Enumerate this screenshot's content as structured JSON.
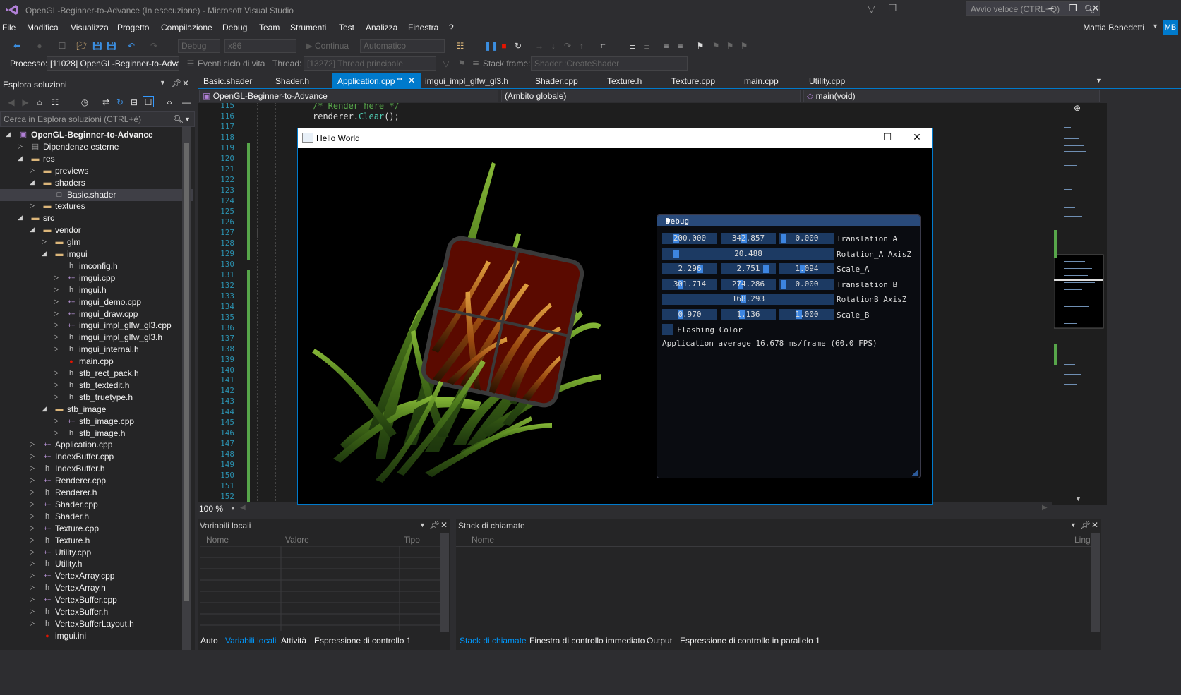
{
  "window": {
    "title": "OpenGL-Beginner-to-Advance (In esecuzione) - Microsoft Visual Studio",
    "quick_launch_placeholder": "Avvio veloce (CTRL+Q)",
    "user_name": "Mattia Benedetti",
    "user_initials": "MB"
  },
  "menu": [
    "File",
    "Modifica",
    "Visualizza",
    "Progetto",
    "Compilazione",
    "Debug",
    "Team",
    "Strumenti",
    "Test",
    "Analizza",
    "Finestra",
    "?"
  ],
  "toolbar": {
    "config": "Debug",
    "platform": "x86",
    "continue": "Continua",
    "automatic": "Automatico",
    "process_label": "Processo:",
    "process_value": "[11028] OpenGL-Beginner-to-Adva",
    "lifecycle": "Eventi ciclo di vita",
    "thread_label": "Thread:",
    "thread_value": "[13272] Thread principale",
    "stackframe_label": "Stack frame:",
    "stackframe_value": "Shader::CreateShader"
  },
  "solution_explorer": {
    "title": "Esplora soluzioni",
    "search_placeholder": "Cerca in Esplora soluzioni (CTRL+è)",
    "items": [
      {
        "label": "OpenGL-Beginner-to-Advance",
        "depth": 0,
        "kind": "project",
        "expanded": true
      },
      {
        "label": "Dipendenze esterne",
        "depth": 1,
        "kind": "deps",
        "expanded": false
      },
      {
        "label": "res",
        "depth": 1,
        "kind": "folder",
        "expanded": true
      },
      {
        "label": "previews",
        "depth": 2,
        "kind": "folder",
        "expanded": false
      },
      {
        "label": "shaders",
        "depth": 2,
        "kind": "folder",
        "expanded": true
      },
      {
        "label": "Basic.shader",
        "depth": 3,
        "kind": "file",
        "selected": true
      },
      {
        "label": "textures",
        "depth": 2,
        "kind": "folder",
        "expanded": false
      },
      {
        "label": "src",
        "depth": 1,
        "kind": "folder",
        "expanded": true
      },
      {
        "label": "vendor",
        "depth": 2,
        "kind": "folder",
        "expanded": true
      },
      {
        "label": "glm",
        "depth": 3,
        "kind": "folder",
        "expanded": false
      },
      {
        "label": "imgui",
        "depth": 3,
        "kind": "folder",
        "expanded": true
      },
      {
        "label": "imconfig.h",
        "depth": 4,
        "kind": "h"
      },
      {
        "label": "imgui.cpp",
        "depth": 4,
        "kind": "cpp",
        "expanded": false
      },
      {
        "label": "imgui.h",
        "depth": 4,
        "kind": "h",
        "expanded": false
      },
      {
        "label": "imgui_demo.cpp",
        "depth": 4,
        "kind": "cpp",
        "expanded": false
      },
      {
        "label": "imgui_draw.cpp",
        "depth": 4,
        "kind": "cpp",
        "expanded": false
      },
      {
        "label": "imgui_impl_glfw_gl3.cpp",
        "depth": 4,
        "kind": "cpp",
        "expanded": false
      },
      {
        "label": "imgui_impl_glfw_gl3.h",
        "depth": 4,
        "kind": "h",
        "expanded": false
      },
      {
        "label": "imgui_internal.h",
        "depth": 4,
        "kind": "h",
        "expanded": false
      },
      {
        "label": "main.cpp",
        "depth": 4,
        "kind": "cpp-err"
      },
      {
        "label": "stb_rect_pack.h",
        "depth": 4,
        "kind": "h",
        "expanded": false
      },
      {
        "label": "stb_textedit.h",
        "depth": 4,
        "kind": "h",
        "expanded": false
      },
      {
        "label": "stb_truetype.h",
        "depth": 4,
        "kind": "h",
        "expanded": false
      },
      {
        "label": "stb_image",
        "depth": 3,
        "kind": "folder",
        "expanded": true
      },
      {
        "label": "stb_image.cpp",
        "depth": 4,
        "kind": "cpp",
        "expanded": false
      },
      {
        "label": "stb_image.h",
        "depth": 4,
        "kind": "h",
        "expanded": false
      },
      {
        "label": "Application.cpp",
        "depth": 2,
        "kind": "cpp",
        "expanded": false
      },
      {
        "label": "IndexBuffer.cpp",
        "depth": 2,
        "kind": "cpp",
        "expanded": false
      },
      {
        "label": "IndexBuffer.h",
        "depth": 2,
        "kind": "h",
        "expanded": false
      },
      {
        "label": "Renderer.cpp",
        "depth": 2,
        "kind": "cpp",
        "expanded": false
      },
      {
        "label": "Renderer.h",
        "depth": 2,
        "kind": "h",
        "expanded": false
      },
      {
        "label": "Shader.cpp",
        "depth": 2,
        "kind": "cpp",
        "expanded": false
      },
      {
        "label": "Shader.h",
        "depth": 2,
        "kind": "h",
        "expanded": false
      },
      {
        "label": "Texture.cpp",
        "depth": 2,
        "kind": "cpp",
        "expanded": false
      },
      {
        "label": "Texture.h",
        "depth": 2,
        "kind": "h",
        "expanded": false
      },
      {
        "label": "Utility.cpp",
        "depth": 2,
        "kind": "cpp",
        "expanded": false
      },
      {
        "label": "Utility.h",
        "depth": 2,
        "kind": "h",
        "expanded": false
      },
      {
        "label": "VertexArray.cpp",
        "depth": 2,
        "kind": "cpp",
        "expanded": false
      },
      {
        "label": "VertexArray.h",
        "depth": 2,
        "kind": "h",
        "expanded": false
      },
      {
        "label": "VertexBuffer.cpp",
        "depth": 2,
        "kind": "cpp",
        "expanded": false
      },
      {
        "label": "VertexBuffer.h",
        "depth": 2,
        "kind": "h",
        "expanded": false
      },
      {
        "label": "VertexBufferLayout.h",
        "depth": 2,
        "kind": "h",
        "expanded": false
      },
      {
        "label": "imgui.ini",
        "depth": 2,
        "kind": "ini-err"
      }
    ]
  },
  "tabs": [
    {
      "label": "Basic.shader"
    },
    {
      "label": "Shader.h"
    },
    {
      "label": "Application.cpp",
      "active": true
    },
    {
      "label": "imgui_impl_glfw_gl3.h"
    },
    {
      "label": "Shader.cpp"
    },
    {
      "label": "Texture.h"
    },
    {
      "label": "Texture.cpp"
    },
    {
      "label": "main.cpp"
    },
    {
      "label": "Utility.cpp"
    }
  ],
  "navbar": {
    "project": "OpenGL-Beginner-to-Advance",
    "scope": "(Ambito globale)",
    "member": "main(void)"
  },
  "editor": {
    "line_start": 115,
    "line_end": 152,
    "code_line_1": "/* Render here */",
    "code_line_2_obj": "renderer.",
    "code_line_2_method": "Clear",
    "code_line_2_end": "();",
    "zoom": "100 %"
  },
  "app_window": {
    "title": "Hello World"
  },
  "debug_panel": {
    "title": "Debug",
    "rows": [
      {
        "values": [
          "200.000",
          "342.857",
          "0.000"
        ],
        "fill": [
          0.2,
          0.4,
          0.0
        ],
        "label": "Translation_A"
      },
      {
        "values": [
          "20.488"
        ],
        "fill": [
          0.06
        ],
        "label": "Rotation_A AxisZ"
      },
      {
        "values": [
          "2.296",
          "2.751",
          "1.094"
        ],
        "fill": [
          0.7,
          0.85,
          0.4
        ],
        "label": "Scale_A"
      },
      {
        "values": [
          "301.714",
          "274.286",
          "0.000"
        ],
        "fill": [
          0.3,
          0.32,
          0.0
        ],
        "label": "Translation_B"
      },
      {
        "values": [
          "168.293"
        ],
        "fill": [
          0.47
        ],
        "label": "RotationB AxisZ"
      },
      {
        "values": [
          "0.970",
          "1.136",
          "1.000"
        ],
        "fill": [
          0.3,
          0.36,
          0.33
        ],
        "label": "Scale_B"
      }
    ],
    "checkbox_label": "Flashing Color",
    "checkbox_checked": false,
    "fps_text": "Application average 16.678 ms/frame (60.0 FPS)"
  },
  "locals_panel": {
    "title": "Variabili locali",
    "columns": [
      "Nome",
      "Valore",
      "Tipo"
    ],
    "tabs": [
      "Auto",
      "Variabili locali",
      "Attività",
      "Espressione di controllo 1"
    ],
    "active_tab": 1
  },
  "callstack_panel": {
    "title": "Stack di chiamate",
    "columns": [
      "Nome",
      "Ling"
    ],
    "tabs": [
      "Stack di chiamate",
      "Finestra di controllo immediato",
      "Output",
      "Espressione di controllo in parallelo 1"
    ],
    "active_tab": 0
  },
  "colors": {
    "accent": "#007acc",
    "background": "#2d2d30",
    "editor_bg": "#1e1e1e",
    "imgui_frame": "#1c3a63",
    "imgui_grab": "#3d85e0"
  }
}
